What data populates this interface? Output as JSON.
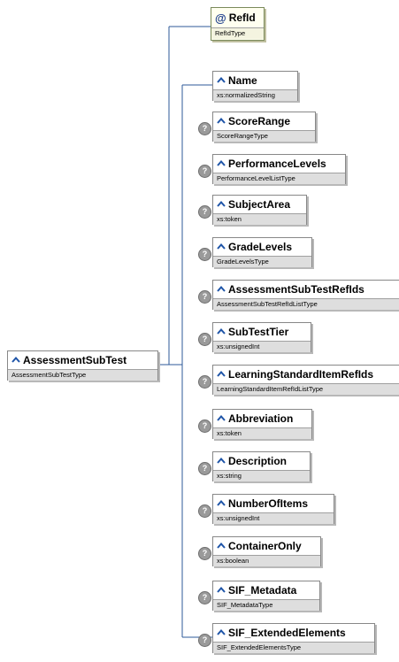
{
  "root": {
    "name": "AssessmentSubTest",
    "type": "AssessmentSubTestType"
  },
  "attribute": {
    "name": "RefId",
    "type": "RefIdType",
    "icon": "at-sign-icon"
  },
  "children": [
    {
      "name": "Name",
      "type": "xs:normalizedString",
      "optional": false
    },
    {
      "name": "ScoreRange",
      "type": "ScoreRangeType",
      "optional": true
    },
    {
      "name": "PerformanceLevels",
      "type": "PerformanceLevelListType",
      "optional": true
    },
    {
      "name": "SubjectArea",
      "type": "xs:token",
      "optional": true
    },
    {
      "name": "GradeLevels",
      "type": "GradeLevelsType",
      "optional": true
    },
    {
      "name": "AssessmentSubTestRefIds",
      "type": "AssessmentSubTestRefIdListType",
      "optional": true
    },
    {
      "name": "SubTestTier",
      "type": "xs:unsignedInt",
      "optional": true
    },
    {
      "name": "LearningStandardItemRefIds",
      "type": "LearningStandardItemRefIdListType",
      "optional": true
    },
    {
      "name": "Abbreviation",
      "type": "xs:token",
      "optional": true
    },
    {
      "name": "Description",
      "type": "xs:string",
      "optional": true
    },
    {
      "name": "NumberOfItems",
      "type": "xs:unsignedInt",
      "optional": true
    },
    {
      "name": "ContainerOnly",
      "type": "xs:boolean",
      "optional": true
    },
    {
      "name": "SIF_Metadata",
      "type": "SIF_MetadataType",
      "optional": true
    },
    {
      "name": "SIF_ExtendedElements",
      "type": "SIF_ExtendedElementsType",
      "optional": true
    }
  ],
  "optional_marker": "?",
  "colors": {
    "connector": "#2e5a9a",
    "element_icon": "#1f55a8",
    "type_band": "#dedede",
    "optional_badge": "#9a9a9a"
  }
}
